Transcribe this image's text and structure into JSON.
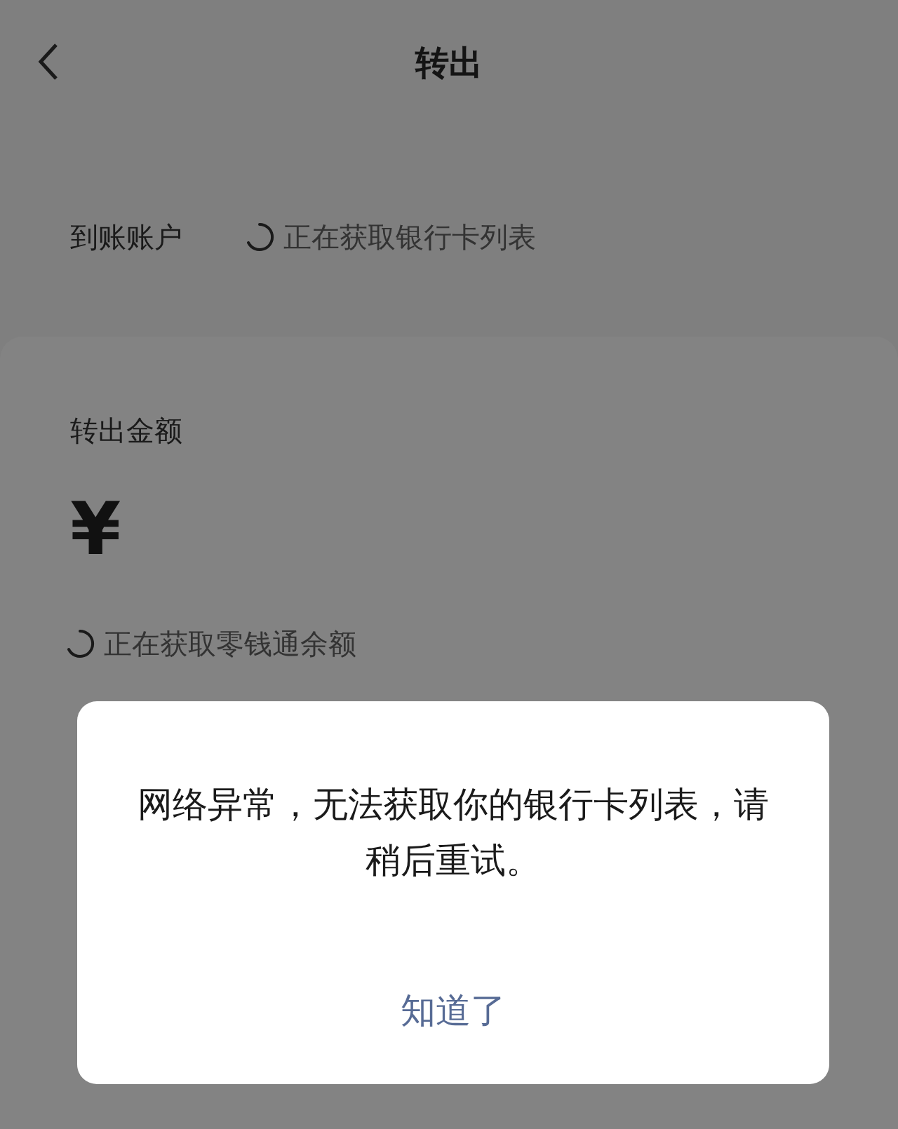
{
  "header": {
    "title": "转出"
  },
  "account": {
    "label": "到账账户",
    "status": "正在获取银行卡列表"
  },
  "amount": {
    "label": "转出金额",
    "currency": "¥",
    "status": "正在获取零钱通余额"
  },
  "dialog": {
    "message": "网络异常，无法获取你的银行卡列表，请稍后重试。",
    "button": "知道了"
  }
}
